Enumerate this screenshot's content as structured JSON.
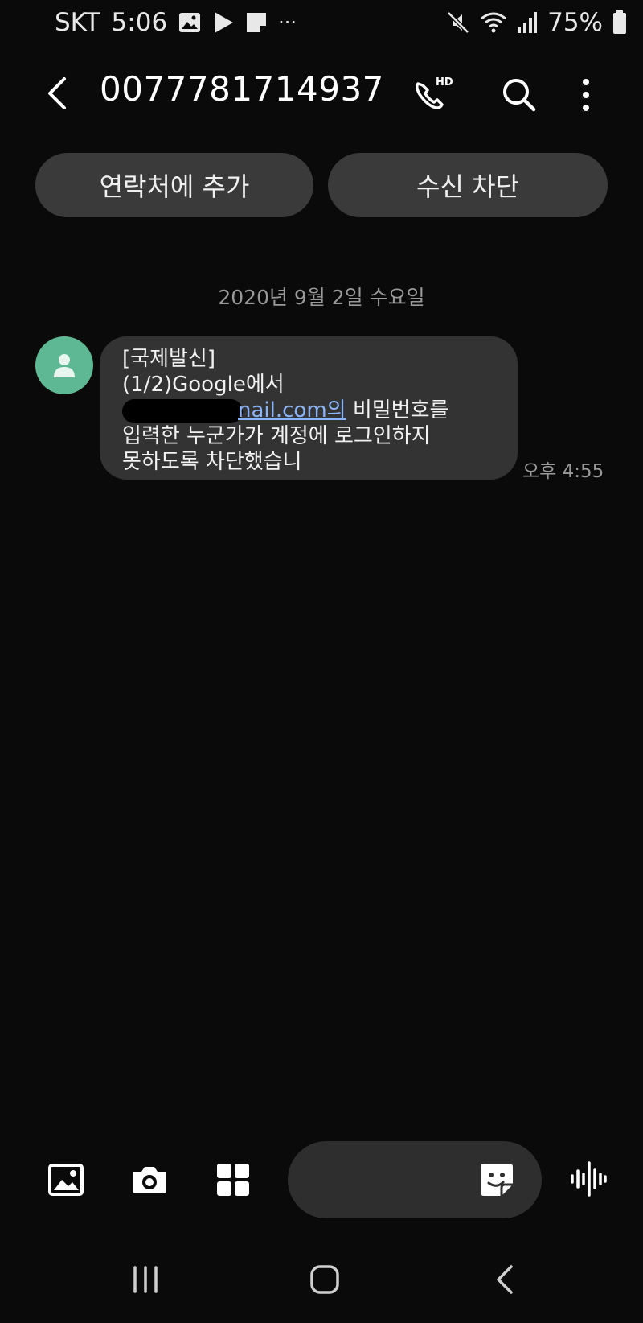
{
  "status_bar": {
    "carrier": "SKT",
    "time": "5:06",
    "more": "···",
    "battery": "75%"
  },
  "header": {
    "phone_number": "0077781714937"
  },
  "actions": {
    "add_contact": "연락처에 추가",
    "block": "수신 차단"
  },
  "conversation": {
    "date": "2020년 9월 2일 수요일",
    "message": {
      "line1": "[국제발신]",
      "line2": "(1/2)Google에서",
      "line3_link": "nail.com의",
      "line3_rest": " 비밀번호를",
      "line4": "입력한 누군가가 계정에 로그인하지",
      "line5": "못하도록 차단했습니",
      "time": "오후 4:55"
    }
  },
  "colors": {
    "background": "#0a0a0a",
    "bubble": "#333333",
    "pill": "#3a3a3a",
    "avatar": "#5fb894",
    "link": "#8ab4f8"
  }
}
